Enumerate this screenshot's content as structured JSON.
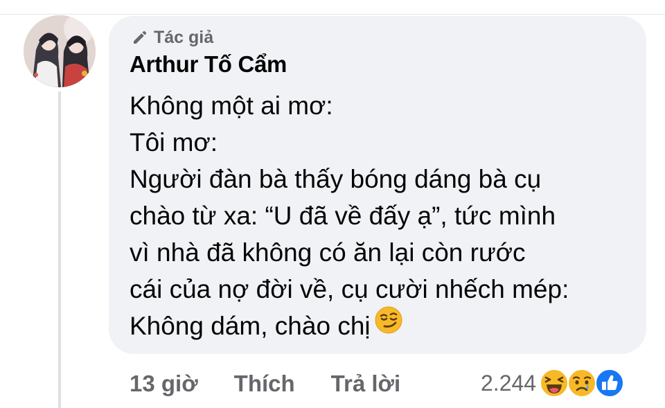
{
  "comment": {
    "badge_label": "Tác giả",
    "author": "Arthur Tố Cẩm",
    "lines": [
      "Không một ai mơ:",
      "Tôi mơ:",
      "Người đàn bà thấy bóng dáng bà cụ",
      "chào từ xa: “U đã về đấy ạ”, tức mình",
      "vì nhà đã không có ăn lại còn rước",
      "cái của nợ đời về, cụ cười nhếch mép:",
      "Không dám, chào chị"
    ],
    "trailing_emoji": "smirking-face-icon"
  },
  "actions": {
    "time": "13 giờ",
    "like": "Thích",
    "reply": "Trả lời"
  },
  "reactions": {
    "count": "2.244",
    "icons": [
      "haha-icon",
      "sad-icon",
      "like-icon"
    ]
  },
  "colors": {
    "bubble": "#f0f2f5",
    "secondary_text": "#65676b",
    "like_blue": "#1877f2",
    "emoji_yellow": "#f7b928"
  }
}
